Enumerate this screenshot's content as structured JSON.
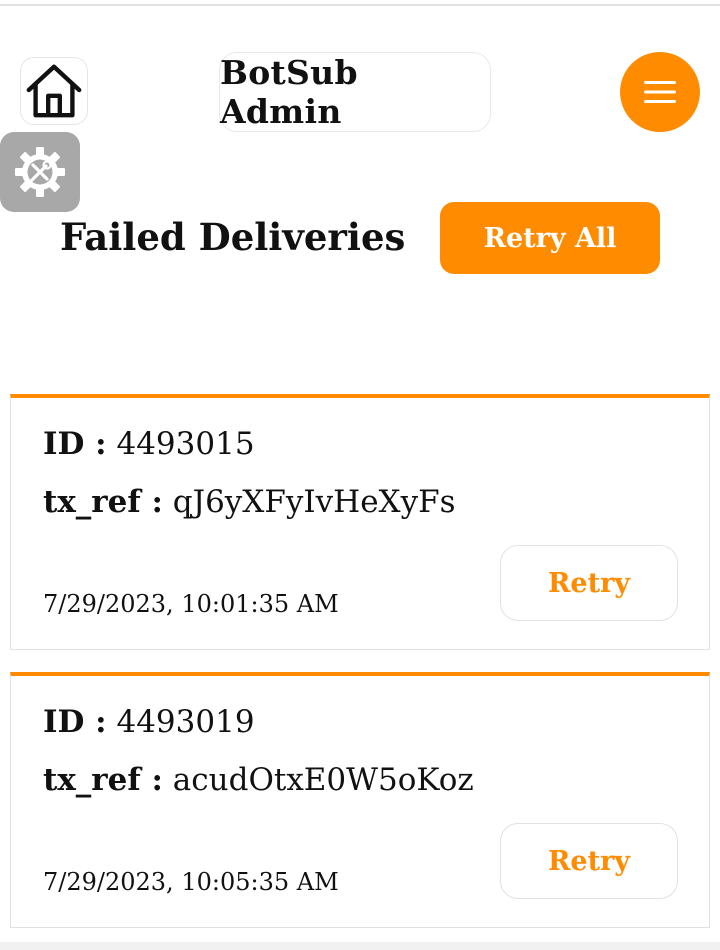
{
  "header": {
    "title": "BotSub Admin",
    "home_icon": "home-icon",
    "menu_icon": "hamburger-menu-icon",
    "settings_icon": "settings-gear-tools-icon"
  },
  "page": {
    "heading": "Failed Deliveries",
    "retry_all_label": "Retry All"
  },
  "labels": {
    "id": "ID :",
    "tx_ref": "tx_ref :"
  },
  "deliveries": [
    {
      "id": "4493015",
      "tx_ref": "qJ6yXFyIvHeXyFs",
      "timestamp": "7/29/2023, 10:01:35 AM",
      "retry_label": "Retry"
    },
    {
      "id": "4493019",
      "tx_ref": "acudOtxE0W5oKoz",
      "timestamp": "7/29/2023, 10:05:35 AM",
      "retry_label": "Retry"
    }
  ],
  "colors": {
    "accent": "#ff8c00",
    "settings_bg": "#a8a8a8",
    "border": "#e2e2e2"
  }
}
